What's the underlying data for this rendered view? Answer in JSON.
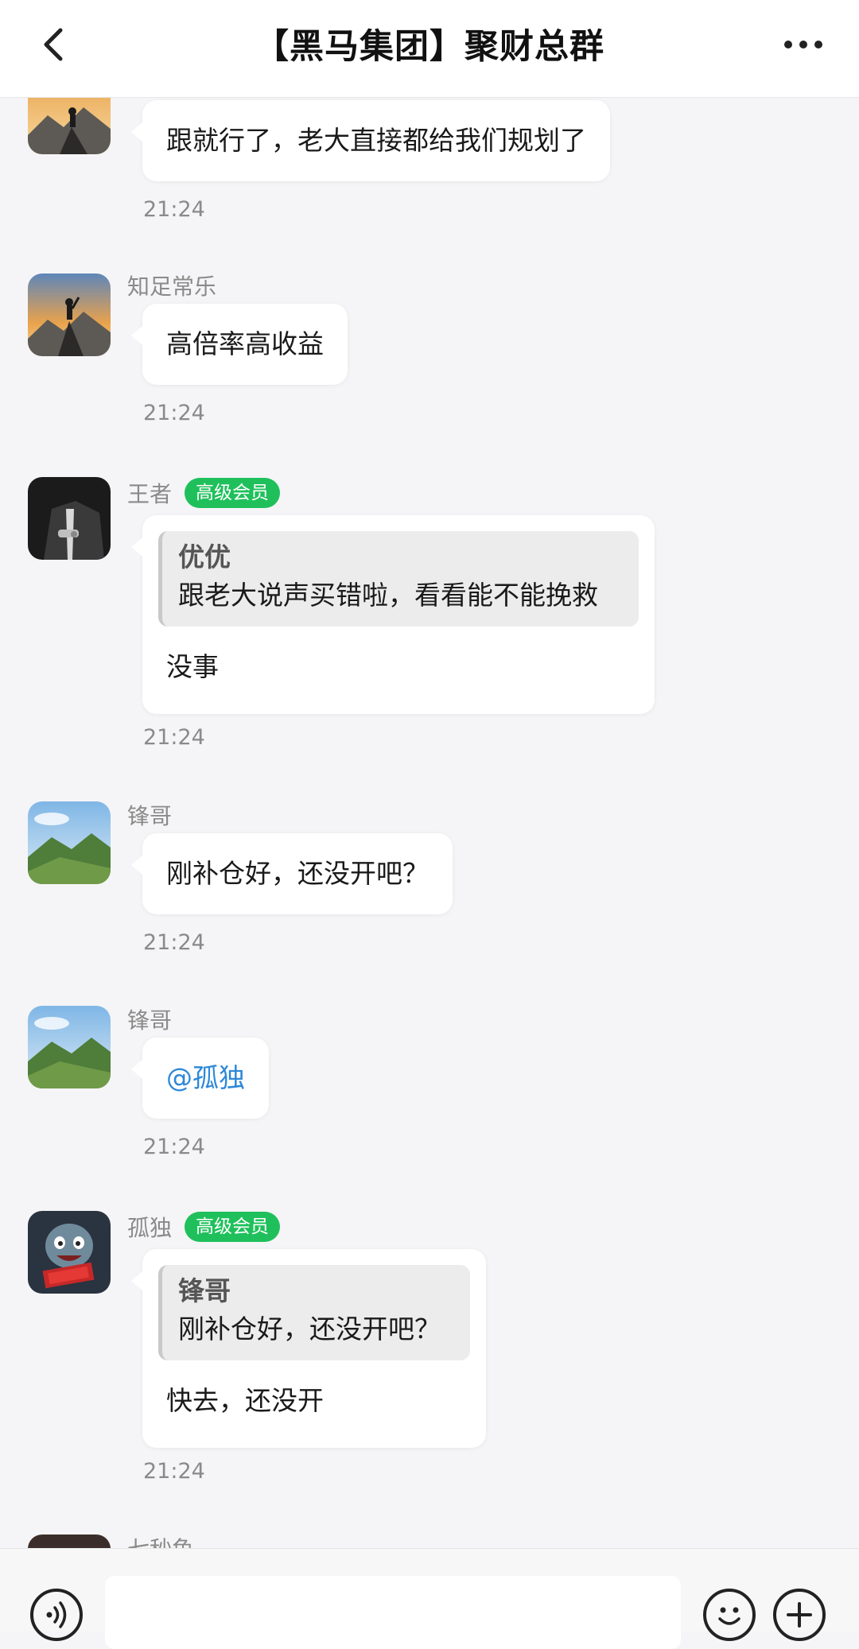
{
  "header": {
    "title": "【黑马集团】聚财总群"
  },
  "messages": [
    {
      "sender": "",
      "badge": "",
      "avatar": "mountain-climber-avatar",
      "text": "跟就行了，老大直接都给我们规划了",
      "time": "21:24"
    },
    {
      "sender": "知足常乐",
      "badge": "",
      "avatar": "mountain-climber-avatar",
      "text": "高倍率高收益",
      "time": "21:24"
    },
    {
      "sender": "王者",
      "badge": "高级会员",
      "avatar": "suited-man-avatar",
      "quote_name": "优优",
      "quote_text": "跟老大说声买错啦，看看能不能挽救",
      "text": "没事",
      "time": "21:24"
    },
    {
      "sender": "锋哥",
      "badge": "",
      "avatar": "green-hills-avatar",
      "text": "刚补仓好，还没开吧？",
      "time": "21:24"
    },
    {
      "sender": "锋哥",
      "badge": "",
      "avatar": "green-hills-avatar",
      "text": "@孤独",
      "time": "21:24"
    },
    {
      "sender": "孤独",
      "badge": "高级会员",
      "avatar": "cartoon-character-avatar",
      "quote_name": "锋哥",
      "quote_text": "刚补仓好，还没开吧？",
      "text": "快去，还没开",
      "time": "21:24"
    },
    {
      "sender": "七秒鱼",
      "badge": "",
      "avatar": "partial-avatar"
    }
  ],
  "colors": {
    "badge_green": "#1fc05b",
    "mention_blue": "#2d88d8",
    "background": "#f5f5f7"
  }
}
